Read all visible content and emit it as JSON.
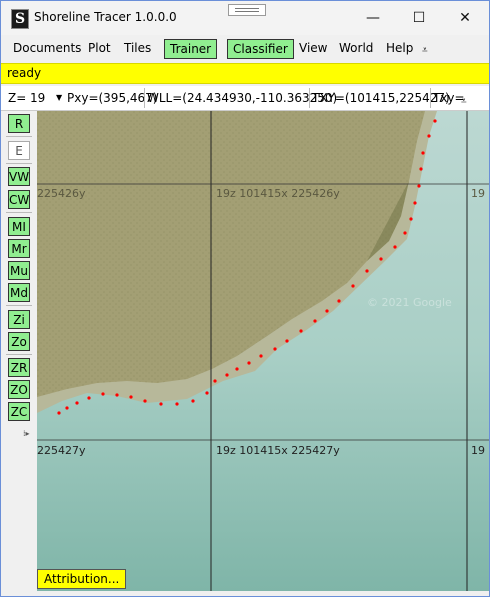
{
  "window": {
    "title": "Shoreline Tracer 1.0.0.0",
    "app_icon_glyph": "S",
    "controls": {
      "minimize": "—",
      "maximize": "☐",
      "close": "✕"
    }
  },
  "menu": {
    "items": [
      "Documents",
      "Plot",
      "Tiles"
    ],
    "trainer": "Trainer",
    "classifier": "Classifier",
    "items2": [
      "View",
      "World",
      "Help"
    ],
    "overflow": "⩡"
  },
  "status": {
    "text": "ready"
  },
  "coords": {
    "zoom_label": "Z=",
    "zoom_value": "19",
    "pxy": "Pxy=(395,467)",
    "wll": "WLL=(24.434930,-110.363250)",
    "txy": "TXY=(101415,225427)",
    "txy2": "Txy=",
    "overflow": "⩡"
  },
  "toolbar": {
    "buttons": [
      "R",
      "E",
      "VW",
      "CW",
      "MI",
      "Mr",
      "Mu",
      "Md",
      "Zi",
      "Zo",
      "ZR",
      "ZO",
      "ZC"
    ],
    "more": "⁞▸"
  },
  "map": {
    "tile_labels": [
      "225426y",
      "19z 101415x 225426y",
      "19",
      "225427y",
      "19z 101415x 225427y",
      "19"
    ],
    "watermark": "© 2021 Google"
  },
  "attribution": {
    "label": "Attribution..."
  },
  "colors": {
    "accent_green": "#90ee90",
    "status_yellow": "#ffff00",
    "trace_red": "#ff0000"
  }
}
